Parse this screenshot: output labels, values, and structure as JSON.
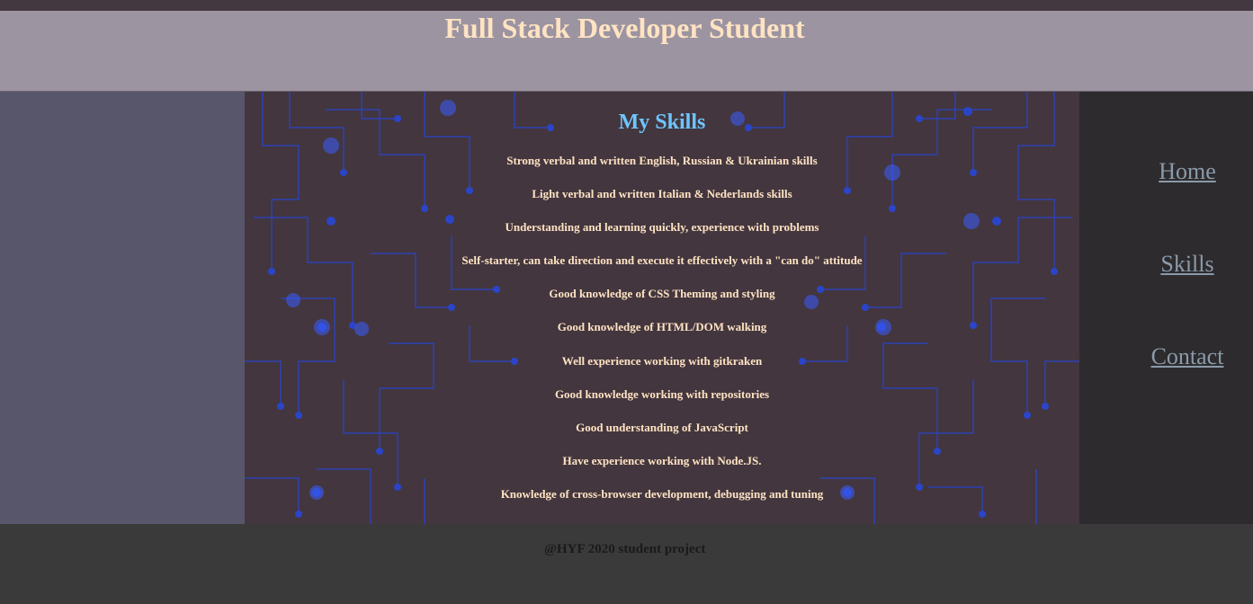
{
  "header": {
    "title": "Full Stack Developer Student"
  },
  "main": {
    "heading": "My Skills",
    "skills": [
      "Strong verbal and written English, Russian & Ukrainian skills",
      "Light verbal and written Italian & Nederlands skills",
      "Understanding and learning quickly, experience with problems",
      "Self-starter, can take direction and execute it effectively with a \"can do\" attitude",
      "Good knowledge of CSS Theming and styling",
      "Good knowledge of HTML/DOM walking",
      "Well experience working with gitkraken",
      "Good knowledge working with repositories",
      "Good understanding of JavaScript",
      "Have experience working with Node.JS.",
      "Knowledge of cross-browser development, debugging and tuning"
    ]
  },
  "nav": {
    "home": "Home",
    "skills": "Skills",
    "contact": "Contact"
  },
  "footer": {
    "text": "@HYF 2020 student project"
  },
  "colors": {
    "header_bg": "#9c94a0",
    "title": "#ffe3c3",
    "heading": "#6ec6ff",
    "main_bg": "#43363e",
    "sidebar_left": "#58566a",
    "nav_bg": "#2d2b2d",
    "nav_link": "#8a9aaa",
    "footer_bg": "#3b3a3b",
    "circuit": "#2a45c8"
  }
}
